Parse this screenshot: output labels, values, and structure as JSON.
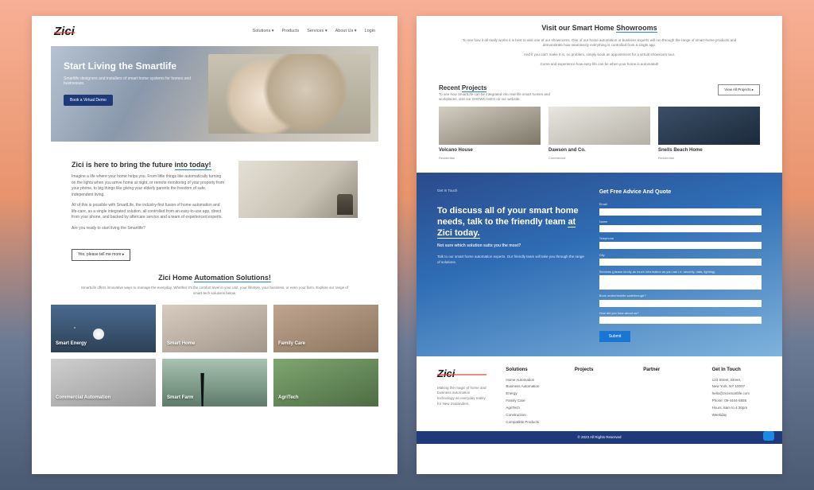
{
  "brand": "Zici",
  "nav": {
    "items": [
      "Solutions ▾",
      "Products",
      "Services ▾",
      "About Us ▾",
      "Login"
    ]
  },
  "hero": {
    "title": "Start Living the Smartlife",
    "subtitle": "Smartlife designers and installers of smart home systems for homes and businesses.",
    "cta": "Book a Virtual Demo"
  },
  "intro": {
    "title_pre": "Zici is here to bring the future ",
    "title_ul": "into today!",
    "p1": "Imagine a life where your home helps you. From little things like automatically turning on the lights when you arrive home at night, or remote monitoring of your property from your phone, to big things like giving your elderly parents the freedom of safe, independent living.",
    "p2": "All of this is possible with SmartLife, the industry-first fusion of home automation and life-care, as a single integrated solution, all controlled from an easy-to-use app, direct from your phone, and backed by aftercare service and a team of experienced experts.",
    "p3": "Are you ready to start living the Smartlife?",
    "read_more": "Yes, please tell me more ▸"
  },
  "solutions": {
    "title_pre": "Zici Home ",
    "title_ul": "Automation Solutions!",
    "subtitle": "SmartLife offers innovative ways to manage the everyday. Whether it's the comfort level in your unit, your lifestyle, your business, or even your farm. Explore our range of smart-tech solutions below.",
    "cards": [
      "Smart Energy",
      "Smart Home",
      "Family Care",
      "Commercial Automation",
      "Smart Farm",
      "AgriTech"
    ]
  },
  "showrooms": {
    "title_pre": "Visit our Smart Home ",
    "title_ul": "Showrooms",
    "p1": "To see how it all really works it is best to visit one of our showrooms. One of our home automation or business experts will run through the range of smart-home products and demonstrate how seamlessly everything is controlled from a single app.",
    "p2": "And if you can't make it in, no problem, simply book an appointment for a virtual showroom tour.",
    "cta": "Come and experience how easy life can be when your home is automated!"
  },
  "projects": {
    "title_pre": "Recent ",
    "title_ul": "Projects",
    "subtitle": "To see how SmartLife can be integrated into real-life smart homes and workplaces, visit our SHOWCASES on our website.",
    "view_all": "View All Projects ▸",
    "items": [
      {
        "name": "Volcano House",
        "meta": "Residential"
      },
      {
        "name": "Dawson and Co.",
        "meta": "Commercial"
      },
      {
        "name": "Snells Beach Home",
        "meta": "Residential"
      }
    ]
  },
  "contact": {
    "small_label": "Get In Touch",
    "heading_l1": "To discuss all of your smart home needs, talk to the friendly team ",
    "heading_ul": "at Zici today.",
    "sub1": "Not sure which solution suits you the most?",
    "sub2": "Talk to our smart home automation experts. Our friendly team will take you through the range of solutions.",
    "form_title": "Get Free Advice And Quote",
    "labels": {
      "email": "Email",
      "name": "Name",
      "phone": "Telephone",
      "city": "City",
      "services": "Services (please kindly as much information as you can i.e. security, data, lighting)",
      "consult": "Book onsite/mobile walkthrough?",
      "hear": "How did you hear about us?"
    },
    "submit": "Submit"
  },
  "footer": {
    "about": "Making the magic of home and business automation technology an everyday reality for New Zealanders.",
    "cols": {
      "solutions": {
        "title": "Solutions",
        "links": [
          "Home Automation",
          "Business Automation",
          "Energy",
          "Family Care",
          "AgriTech",
          "Construction",
          "Compatible Products"
        ]
      },
      "projects": {
        "title": "Projects"
      },
      "partner": {
        "title": "Partner"
      },
      "touch": {
        "title": "Get In Touch",
        "lines": [
          "123 Street, Street,",
          "New York, NY 10007",
          "hello@zicismartlife.com",
          "Phone: 09-4444-5555",
          "Hours: 8am to 4:30pm",
          "Weekday"
        ]
      }
    },
    "copyright": "© 2023 All Rights Reserved"
  }
}
